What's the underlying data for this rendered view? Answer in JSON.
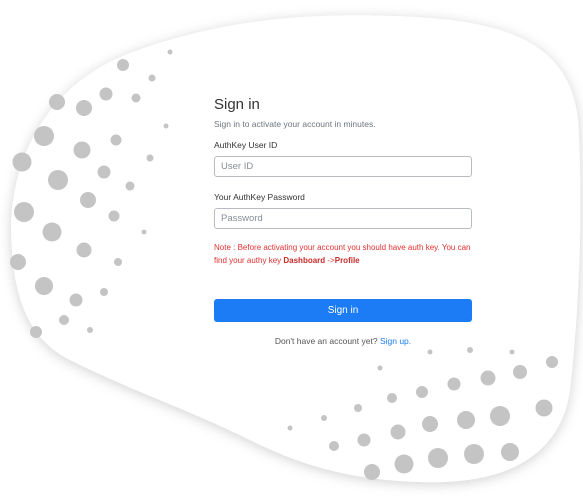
{
  "colors": {
    "primary": "#1b7cf5",
    "note_red": "#e03131",
    "dot_gray": "#c4c4c4"
  },
  "form": {
    "title": "Sign in",
    "subtitle": "Sign in to activate your account in minutes.",
    "user_id": {
      "label": "AuthKey User ID",
      "placeholder": "User ID",
      "value": ""
    },
    "password": {
      "label": "Your AuthKey Password",
      "placeholder": "Password",
      "value": ""
    },
    "note": {
      "text_line1": "Note : Before activating your account you should have auth key. You can find your authy key ",
      "dashboard": "Dashboard",
      "arrow": " ->",
      "profile": "Profile"
    },
    "submit_label": "Sign in",
    "signup_prompt": "Don't have an account yet?",
    "signup_link": "Sign up."
  }
}
